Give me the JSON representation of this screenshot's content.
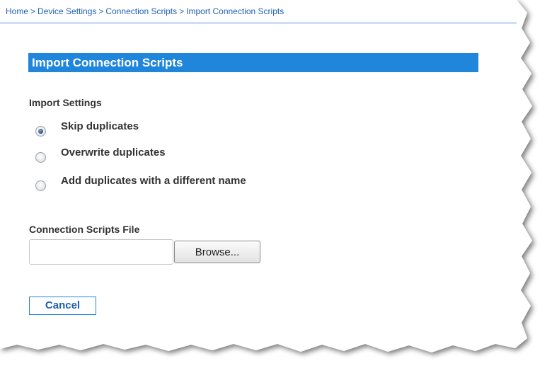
{
  "breadcrumb": {
    "items": [
      "Home",
      "Device Settings",
      "Connection Scripts"
    ],
    "separator": ">",
    "current": "Import Connection Scripts"
  },
  "panel": {
    "title": "Import Connection Scripts",
    "title_bg": "#1f86db"
  },
  "import_settings": {
    "label": "Import Settings",
    "options": [
      {
        "label": "Skip duplicates",
        "checked": true
      },
      {
        "label": "Overwrite duplicates",
        "checked": false
      },
      {
        "label": "Add duplicates with a different name",
        "checked": false
      }
    ]
  },
  "file": {
    "label": "Connection Scripts File",
    "value": "",
    "browse_label": "Browse..."
  },
  "actions": {
    "cancel_label": "Cancel"
  },
  "colors": {
    "link": "#1f5fb3",
    "accent": "#1f86db"
  }
}
